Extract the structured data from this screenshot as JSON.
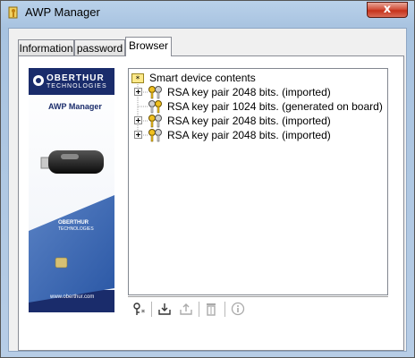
{
  "window": {
    "title": "AWP Manager",
    "close_label": "x"
  },
  "tabs": [
    {
      "label": "Information",
      "active": false
    },
    {
      "label": "password",
      "active": false
    },
    {
      "label": "Browser",
      "active": true
    }
  ],
  "banner": {
    "brand_line1": "OBERTHUR",
    "brand_line2": "TECHNOLOGIES",
    "product": "AWP Manager",
    "card_brand_line1": "OBERTHUR",
    "card_brand_line2": "TECHNOLOGIES",
    "url": "www.oberthur.com",
    "colors": {
      "navy": "#1a2c6b",
      "blue": "#2a57a5"
    }
  },
  "tree": {
    "root": {
      "label": "Smart device contents",
      "icon": "folder-star-icon"
    },
    "items": [
      {
        "label": "RSA key pair 2048 bits. (imported)",
        "expandable": true,
        "icon": "key-pair-icon"
      },
      {
        "label": "RSA key pair 1024 bits. (generated on board)",
        "expandable": false,
        "icon": "key-pair-icon"
      },
      {
        "label": "RSA key pair 2048 bits. (imported)",
        "expandable": true,
        "icon": "key-pair-icon"
      },
      {
        "label": "RSA key pair 2048 bits. (imported)",
        "expandable": true,
        "icon": "key-pair-icon"
      }
    ]
  },
  "toolbar": [
    {
      "name": "generate-key-button",
      "icon": "key-star-icon",
      "enabled": true
    },
    {
      "name": "import-button",
      "icon": "import-icon",
      "enabled": true
    },
    {
      "name": "export-button",
      "icon": "export-icon",
      "enabled": false
    },
    {
      "name": "delete-button",
      "icon": "trash-icon",
      "enabled": false
    },
    {
      "name": "properties-button",
      "icon": "info-icon",
      "enabled": false
    }
  ]
}
